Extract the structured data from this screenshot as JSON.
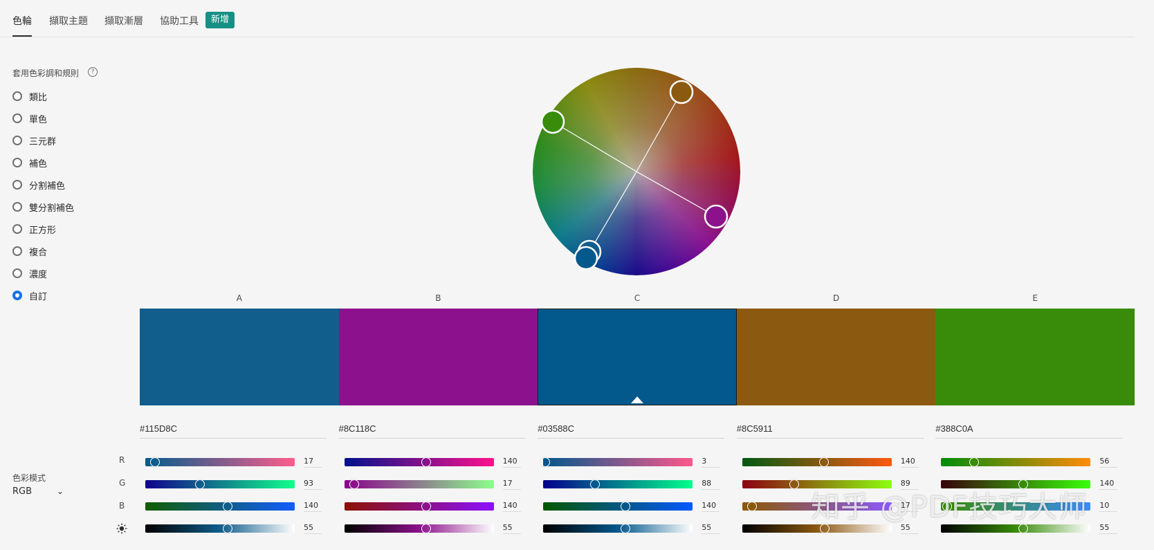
{
  "tabs": [
    {
      "label": "色輪",
      "active": true
    },
    {
      "label": "擷取主題",
      "active": false
    },
    {
      "label": "擷取漸層",
      "active": false
    },
    {
      "label": "協助工具",
      "active": false
    }
  ],
  "new_button_label": "新增",
  "harmony": {
    "title": "套用色彩調和規則",
    "help_icon": "?",
    "rules": [
      "類比",
      "單色",
      "三元群",
      "補色",
      "分割補色",
      "雙分割補色",
      "正方形",
      "複合",
      "濃度",
      "自訂"
    ],
    "selected": "自訂"
  },
  "color_mode": {
    "label": "色彩模式",
    "value": "RGB"
  },
  "channels": [
    "R",
    "G",
    "B",
    "brightness-icon"
  ],
  "swatches": [
    {
      "letter": "A",
      "hex": "#115D8C",
      "color": "#115D8C",
      "values": {
        "r": 17,
        "g": 93,
        "b": 140,
        "brightness": 55
      }
    },
    {
      "letter": "B",
      "hex": "#8C118C",
      "color": "#8C118C",
      "values": {
        "r": 140,
        "g": 17,
        "b": 140,
        "brightness": 55
      }
    },
    {
      "letter": "C",
      "hex": "#03588C",
      "color": "#03588C",
      "values": {
        "r": 3,
        "g": 88,
        "b": 140,
        "brightness": 55
      }
    },
    {
      "letter": "D",
      "hex": "#8C5911",
      "color": "#8C5911",
      "values": {
        "r": 140,
        "g": 89,
        "b": 17,
        "brightness": 55
      }
    },
    {
      "letter": "E",
      "hex": "#388C0A",
      "color": "#388C0A",
      "values": {
        "r": 56,
        "g": 140,
        "b": 10,
        "brightness": 55
      }
    }
  ],
  "selected_swatch": "C",
  "watermark": "知乎 @PDF技巧大师"
}
